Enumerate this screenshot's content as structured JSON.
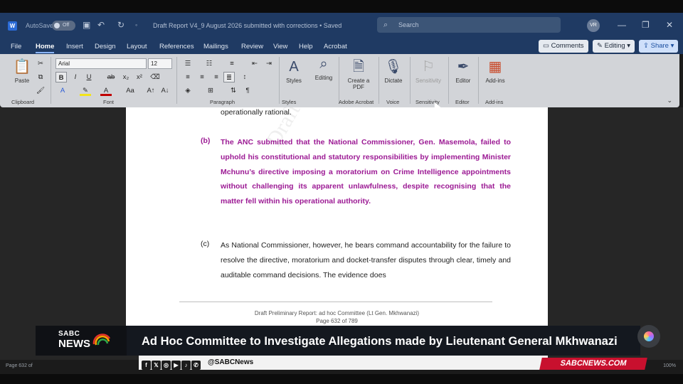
{
  "window": {
    "autosave_label": "AutoSave",
    "autosave_state": "Off",
    "doc_title": "Draft Report V4_9 August 2026 submitted with corrections • Saved",
    "search_placeholder": "Search",
    "avatar_initials": "VR"
  },
  "menu": {
    "tabs": [
      "File",
      "Home",
      "Insert",
      "Design",
      "Layout",
      "References",
      "Mailings",
      "Review",
      "View",
      "Help",
      "Acrobat"
    ],
    "active_tab": "Home",
    "comments_label": "Comments",
    "editing_label": "Editing",
    "share_label": "Share"
  },
  "ribbon": {
    "paste_label": "Paste",
    "font_name": "Arial",
    "font_size": "12",
    "styles_label": "Styles",
    "editing_label": "Editing",
    "create_pdf_label": "Create a PDF",
    "dictate_label": "Dictate",
    "sensitivity_label": "Sensitivity",
    "editor_label": "Editor",
    "addins_label": "Add-ins",
    "groups": {
      "clipboard": "Clipboard",
      "font": "Font",
      "paragraph": "Paragraph",
      "styles": "Styles",
      "adobe": "Adobe Acrobat",
      "voice": "Voice",
      "sensitivity": "Sensitivity",
      "editor": "Editor",
      "addins": "Add-ins"
    }
  },
  "document": {
    "watermark": "Draft",
    "line_top": "operationally rational.",
    "para_b_marker": "(b)",
    "para_b_text": "The ANC submitted that the National Commissioner, Gen. Masemola, failed to uphold his constitutional and statutory responsibilities by implementing Minister Mchunu’s directive imposing a moratorium on Crime Intelligence appointments without challenging its apparent unlawfulness, despite recognising that the matter fell within his operational authority.",
    "para_c_marker": "(c)",
    "para_c_text": "As National Commissioner, however, he bears command accountability for the failure to resolve the directive, moratorium and docket-transfer disputes through clear, timely and auditable command decisions. The evidence does",
    "footer_line1": "Draft Preliminary Report: ad hoc Committee (Lt Gen. Mkhwanazi)",
    "footer_line2": "Page 632 of 789"
  },
  "status": {
    "page_info": "Page 632 of",
    "zoom": "100%"
  },
  "broadcast": {
    "sabc": "SABC",
    "news": "NEWS",
    "headline": "Ad Hoc Committee to Investigate Allegations made by Lieutenant General Mkhwanazi",
    "handle": "@SABCNews",
    "site": "SABCNEWS.COM",
    "social_icons": [
      "facebook-icon",
      "x-icon",
      "instagram-icon",
      "youtube-icon",
      "tiktok-icon",
      "whatsapp-icon"
    ]
  },
  "colors": {
    "titlebar": "#1f3a63",
    "ribbon": "#d2d4d8",
    "highlight_text": "#9c1a94",
    "sabc_red": "#c8102e"
  }
}
